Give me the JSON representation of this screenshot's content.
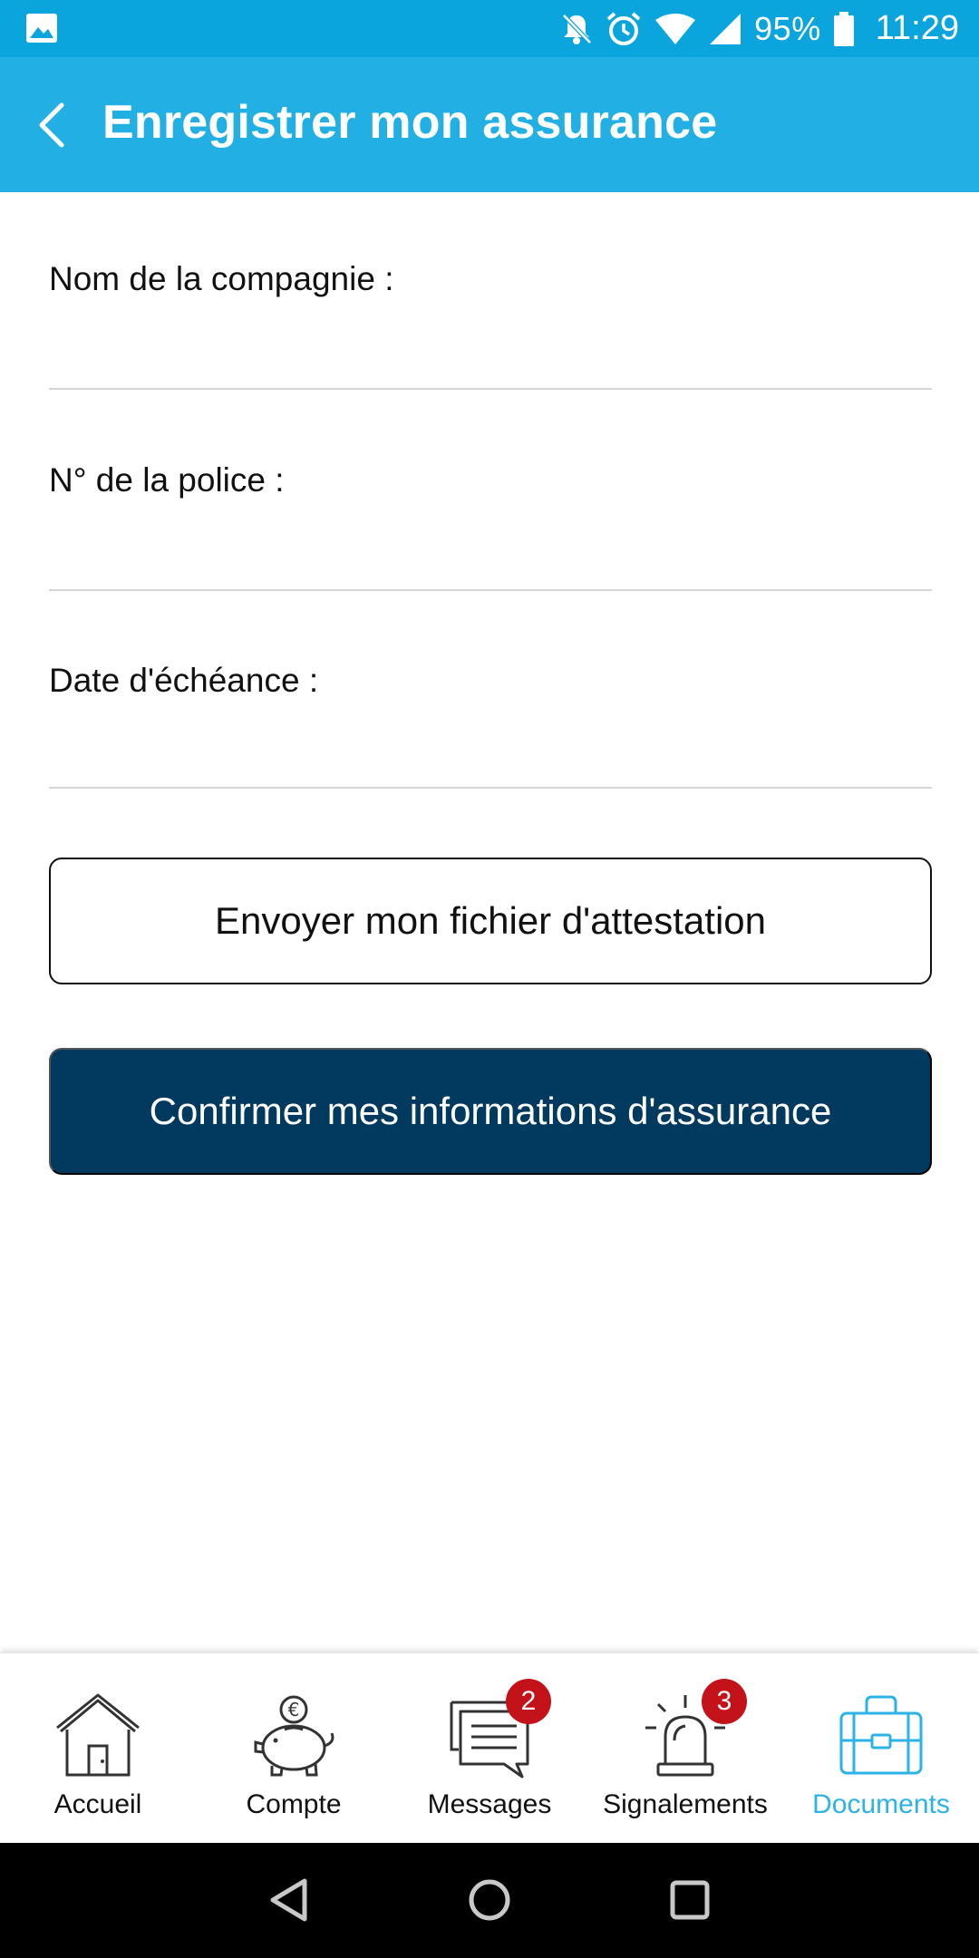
{
  "status_bar": {
    "battery": "95%",
    "time": "11:29",
    "icons": [
      "gallery-icon",
      "bell-off-icon",
      "alarm-icon",
      "wifi-icon",
      "signal-icon",
      "battery-icon"
    ]
  },
  "header": {
    "title": "Enregistrer mon assurance",
    "back_icon": "back-arrow-icon"
  },
  "form": {
    "company_label": "Nom de la compagnie :",
    "company_value": "",
    "policy_label": "N° de la police :",
    "policy_value": "",
    "due_date_label": "Date d'échéance :",
    "due_date_value": ""
  },
  "buttons": {
    "upload_label": "Envoyer mon fichier d'attestation",
    "confirm_label": "Confirmer mes informations d'assurance"
  },
  "bottom_nav": {
    "items": [
      {
        "label": "Accueil",
        "icon": "house-icon"
      },
      {
        "label": "Compte",
        "icon": "piggy-bank-icon"
      },
      {
        "label": "Messages",
        "icon": "messages-icon",
        "badge": "2"
      },
      {
        "label": "Signalements",
        "icon": "alarm-light-icon",
        "badge": "3"
      },
      {
        "label": "Documents",
        "icon": "briefcase-icon",
        "active": true
      }
    ]
  },
  "colors": {
    "status_bar": "#0aa5dd",
    "app_bar": "#22b0e4",
    "primary_button": "#013a5e",
    "active_tab": "#2bb3e6",
    "badge": "#c4121a"
  }
}
